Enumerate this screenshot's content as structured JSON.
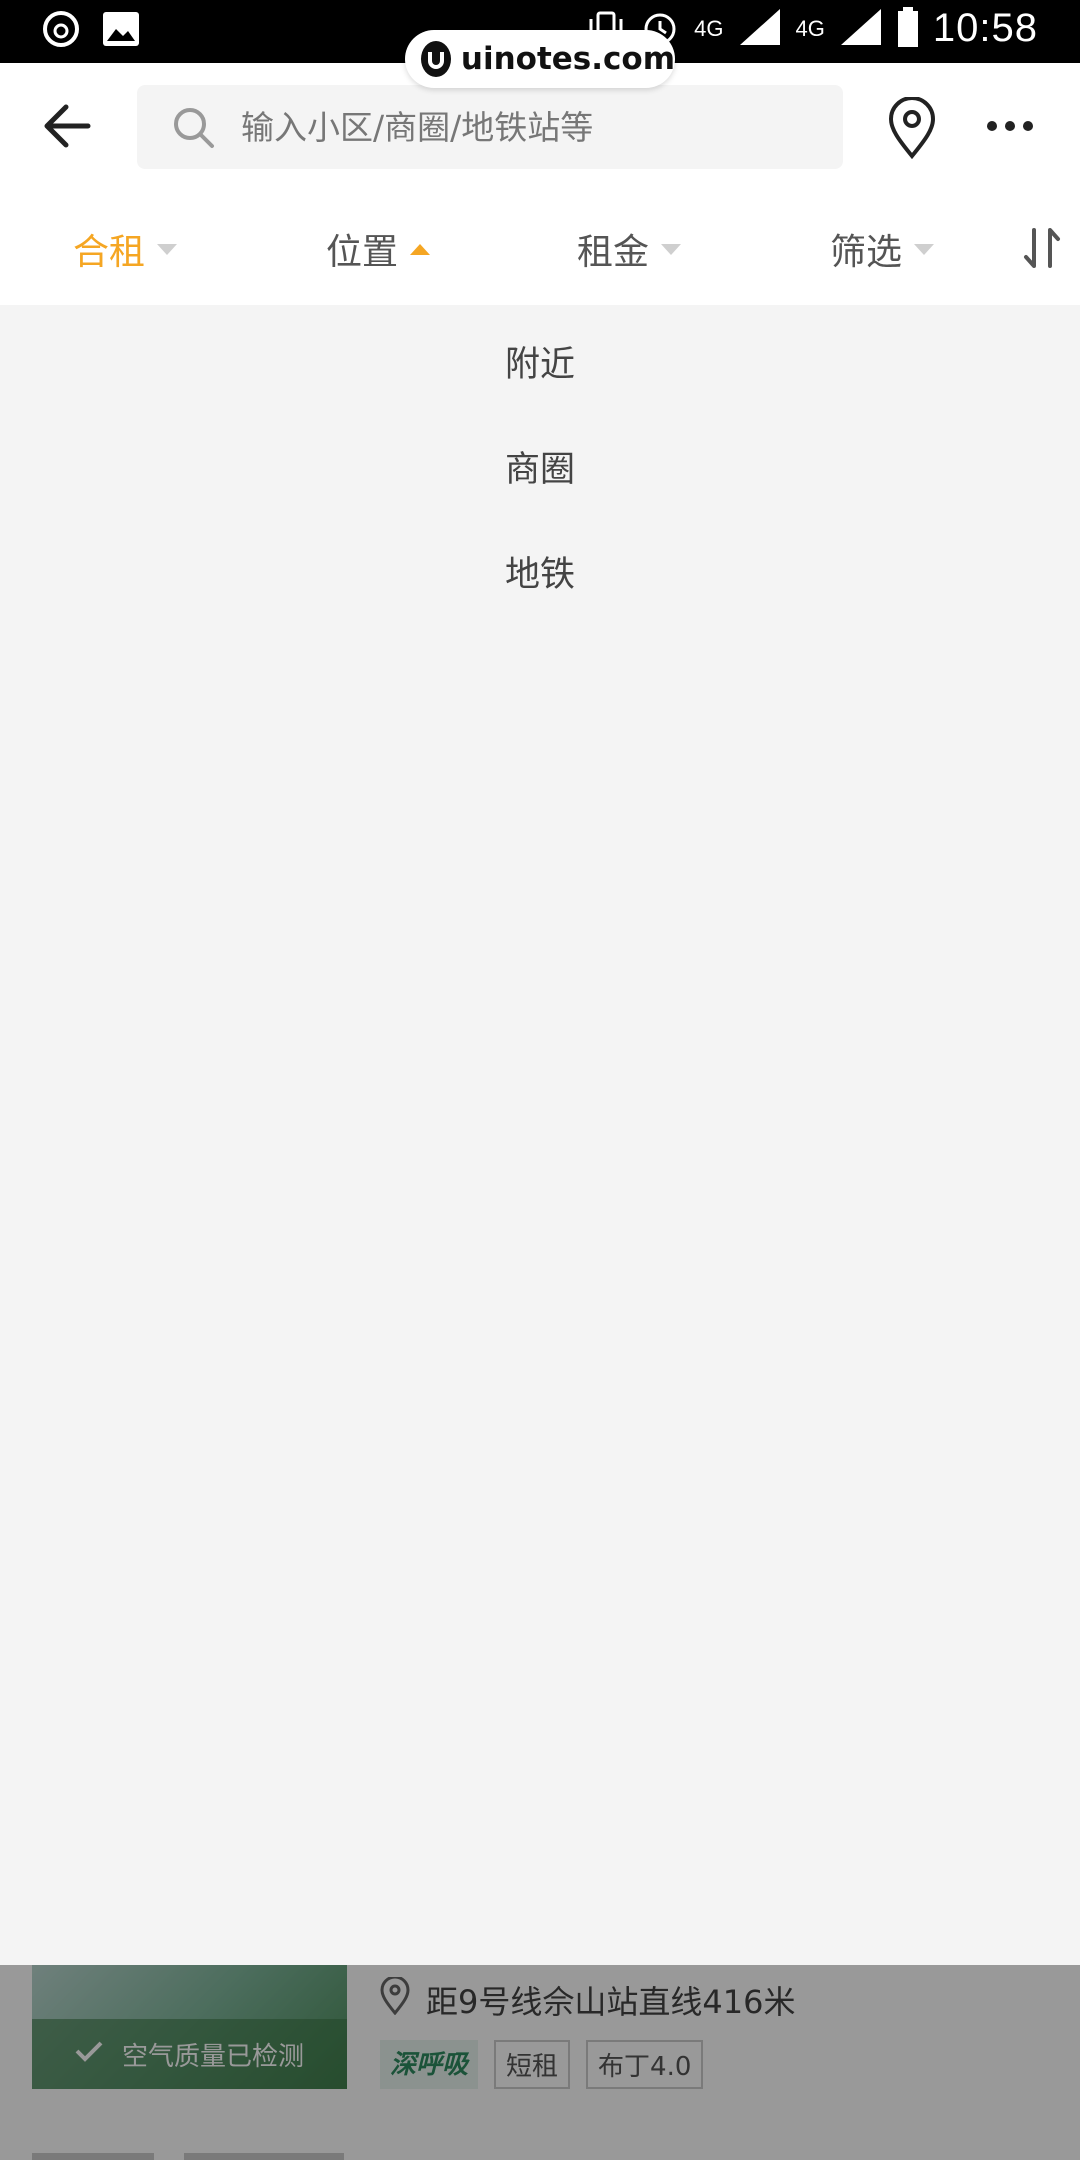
{
  "status_bar": {
    "time": "10:58",
    "network_label_1": "4G",
    "network_label_2": "4G"
  },
  "watermark": {
    "text": "uinotes.com"
  },
  "header": {
    "search_placeholder": "输入小区/商圈/地铁站等"
  },
  "filters": {
    "tabs": [
      {
        "label": "合租",
        "state": "selected"
      },
      {
        "label": "位置",
        "state": "open"
      },
      {
        "label": "租金",
        "state": "closed"
      },
      {
        "label": "筛选",
        "state": "closed"
      }
    ]
  },
  "dropdown": {
    "options": [
      "附近",
      "商圈",
      "地铁"
    ]
  },
  "listing": {
    "badge": "空气质量已检测",
    "location": "距9号线佘山站直线416米",
    "tags": [
      "深呼吸",
      "短租",
      "布丁4.0"
    ]
  },
  "colors": {
    "accent": "#f5a623",
    "background": "#f4f4f4"
  }
}
